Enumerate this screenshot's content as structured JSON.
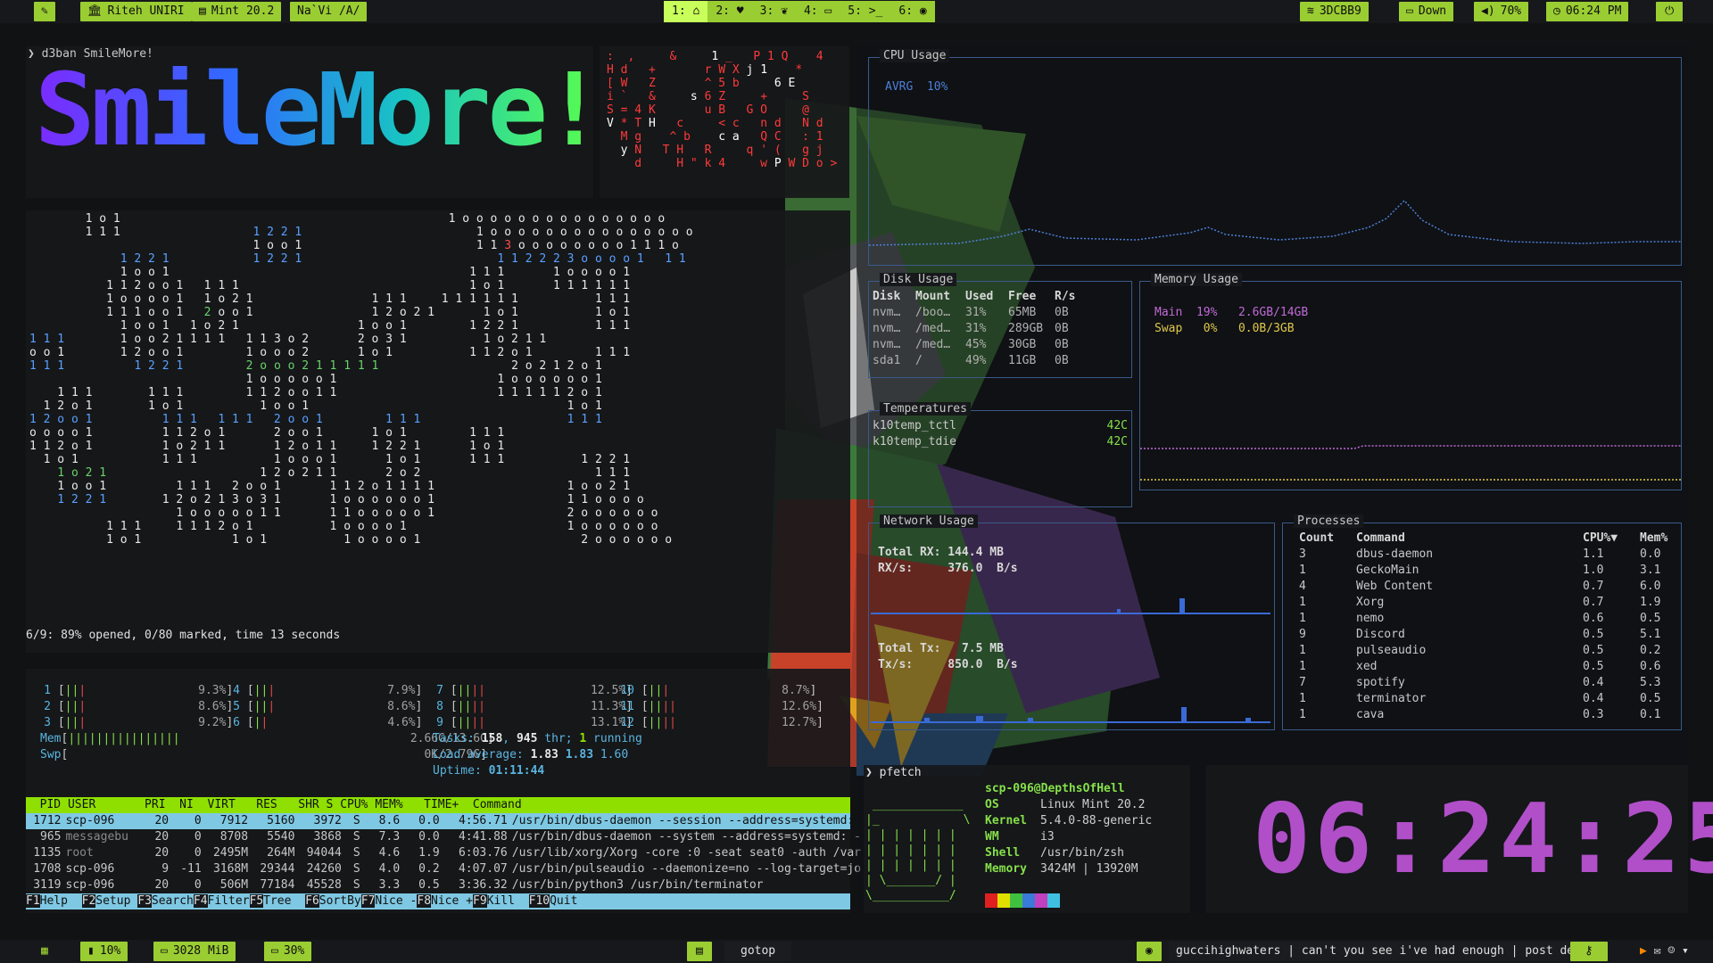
{
  "topbar": {
    "left": [
      {
        "icon": "brush-icon",
        "label": ""
      },
      {
        "icon": "bank-icon",
        "label": "Riteh UNIRI"
      },
      {
        "icon": "card-icon",
        "label": "Mint 20.2"
      },
      {
        "icon": "",
        "label": "Na`Vi /A/"
      }
    ],
    "workspaces": [
      "1:",
      "2:",
      "3:",
      "4:",
      "5:",
      "6:"
    ],
    "workspace_icons": [
      "home-icon",
      "heart-icon",
      "paw-icon",
      "monitor-icon",
      "terminal-icon",
      "spotify-icon"
    ],
    "right": [
      {
        "icon": "wifi-icon",
        "label": "3DCBB9"
      },
      {
        "icon": "folder-icon",
        "label": "Down"
      },
      {
        "icon": "volume-icon",
        "label": "70%"
      },
      {
        "icon": "clock-icon",
        "label": "06:24 PM"
      },
      {
        "icon": "power-icon",
        "label": ""
      }
    ]
  },
  "figlet": {
    "prompt": "❯ d3ban SmileMore!",
    "text": "SmileMore!"
  },
  "matrix_status": "6/9: 89% opened, 0/80 marked, time 13 seconds",
  "htop": {
    "cpus": [
      {
        "n": "1",
        "pct": "9.3%"
      },
      {
        "n": "2",
        "pct": "8.6%"
      },
      {
        "n": "3",
        "pct": "9.2%"
      },
      {
        "n": "4",
        "pct": "7.9%"
      },
      {
        "n": "5",
        "pct": "8.6%"
      },
      {
        "n": "6",
        "pct": "4.6%"
      },
      {
        "n": "7",
        "pct": "12.5%"
      },
      {
        "n": "8",
        "pct": "11.3%"
      },
      {
        "n": "9",
        "pct": "13.1%"
      },
      {
        "n": "10",
        "pct": "8.7%"
      },
      {
        "n": "11",
        "pct": "12.6%"
      },
      {
        "n": "12",
        "pct": "12.7%"
      }
    ],
    "mem": "2.66G/13.6G",
    "swp": "0K/2.79G",
    "tasks": "158",
    "thr": "945",
    "running": "1",
    "load": [
      "1.83",
      "1.83",
      "1.60"
    ],
    "uptime": "01:11:44",
    "header": "  PID USER       PRI  NI  VIRT   RES   SHR S CPU% MEM%   TIME+  Command",
    "rows": [
      {
        "pid": "1712",
        "user": "scp-096",
        "pri": "20",
        "ni": "0",
        "virt": "7912",
        "res": "5160",
        "shr": "3972",
        "s": "S",
        "cpu": "8.6",
        "mem": "0.0",
        "time": "4:56.71",
        "cmd": "/usr/bin/dbus-daemon --session --address=systemd:"
      },
      {
        "pid": "965",
        "user": "messagebu",
        "pri": "20",
        "ni": "0",
        "virt": "8708",
        "res": "5540",
        "shr": "3868",
        "s": "S",
        "cpu": "7.3",
        "mem": "0.0",
        "time": "4:41.88",
        "cmd": "/usr/bin/dbus-daemon --system --address=systemd: -"
      },
      {
        "pid": "1135",
        "user": "root",
        "pri": "20",
        "ni": "0",
        "virt": "2495M",
        "res": "264M",
        "shr": "94044",
        "s": "S",
        "cpu": "4.6",
        "mem": "1.9",
        "time": "6:03.76",
        "cmd": "/usr/lib/xorg/Xorg -core :0 -seat seat0 -auth /var"
      },
      {
        "pid": "1708",
        "user": "scp-096",
        "pri": "9",
        "ni": "-11",
        "virt": "3168M",
        "res": "29344",
        "shr": "24260",
        "s": "S",
        "cpu": "4.0",
        "mem": "0.2",
        "time": "4:07.07",
        "cmd": "/usr/bin/pulseaudio --daemonize=no --log-target=jo"
      },
      {
        "pid": "3119",
        "user": "scp-096",
        "pri": "20",
        "ni": "0",
        "virt": "506M",
        "res": "77184",
        "shr": "45528",
        "s": "S",
        "cpu": "3.3",
        "mem": "0.5",
        "time": "3:36.32",
        "cmd": "/usr/bin/python3 /usr/bin/terminator"
      }
    ],
    "fkeys": [
      {
        "k": "F1",
        "l": "Help  "
      },
      {
        "k": "F2",
        "l": "Setup "
      },
      {
        "k": "F3",
        "l": "Search"
      },
      {
        "k": "F4",
        "l": "Filter"
      },
      {
        "k": "F5",
        "l": "Tree  "
      },
      {
        "k": "F6",
        "l": "SortBy"
      },
      {
        "k": "F7",
        "l": "Nice -"
      },
      {
        "k": "F8",
        "l": "Nice +"
      },
      {
        "k": "F9",
        "l": "Kill  "
      },
      {
        "k": "F10",
        "l": "Quit"
      }
    ]
  },
  "gotop": {
    "cpu": {
      "title": "CPU Usage",
      "avg_label": "AVRG",
      "avg": "10%"
    },
    "disk": {
      "title": "Disk Usage",
      "headers": [
        "Disk",
        "Mount",
        "Used",
        "Free",
        "R/s"
      ],
      "rows": [
        [
          "nvm…",
          "/boo…",
          "31%",
          "65MB",
          "0B"
        ],
        [
          "nvm…",
          "/med…",
          "31%",
          "289GB",
          "0B"
        ],
        [
          "nvm…",
          "/med…",
          "45%",
          "30GB",
          "0B"
        ],
        [
          "sda1",
          "/",
          "49%",
          "11GB",
          "0B"
        ]
      ]
    },
    "memory": {
      "title": "Memory Usage",
      "main_label": "Main",
      "main_pct": "19%",
      "main_val": "2.6GB/14GB",
      "swap_label": "Swap",
      "swap_pct": "0%",
      "swap_val": "0.0B/3GB"
    },
    "temps": {
      "title": "Temperatures",
      "rows": [
        [
          "k10temp_tctl",
          "42C"
        ],
        [
          "k10temp_tdie",
          "42C"
        ]
      ]
    },
    "network": {
      "title": "Network Usage",
      "rx_total_label": "Total RX:",
      "rx_total": "144.4 MB",
      "rx_label": "RX/s:",
      "rx": "376.0  B/s",
      "tx_total_label": "Total Tx:",
      "tx_total": "7.5 MB",
      "tx_label": "Tx/s:",
      "tx": "850.0  B/s"
    },
    "processes": {
      "title": "Processes",
      "headers": [
        "Count",
        "Command",
        "CPU%▼",
        "Mem%"
      ],
      "rows": [
        [
          "3",
          "dbus-daemon",
          "1.1",
          "0.0"
        ],
        [
          "1",
          "GeckoMain",
          "1.0",
          "3.1"
        ],
        [
          "4",
          "Web Content",
          "0.7",
          "6.0"
        ],
        [
          "1",
          "Xorg",
          "0.7",
          "1.9"
        ],
        [
          "1",
          "nemo",
          "0.6",
          "0.5"
        ],
        [
          "9",
          "Discord",
          "0.5",
          "5.1"
        ],
        [
          "1",
          "pulseaudio",
          "0.5",
          "0.2"
        ],
        [
          "1",
          "xed",
          "0.5",
          "0.6"
        ],
        [
          "7",
          "spotify",
          "0.4",
          "5.3"
        ],
        [
          "1",
          "terminator",
          "0.4",
          "0.5"
        ],
        [
          "1",
          "cava",
          "0.3",
          "0.1"
        ]
      ]
    }
  },
  "pfetch": {
    "prompt": "❯ pfetch",
    "userhost": "scp-096@DepthsOfHell",
    "rows": [
      [
        "OS",
        "Linux Mint 20.2"
      ],
      [
        "Kernel",
        "5.4.0-88-generic"
      ],
      [
        "WM",
        "i3"
      ],
      [
        "Shell",
        "/usr/bin/zsh"
      ],
      [
        "Memory",
        "3424M | 13920M"
      ]
    ],
    "ascii": [
      " _____________",
      "|_            \\",
      "| | | | | | |",
      "| | | | | | |",
      "| | | | | | |",
      "| \\_______/ |",
      "\\___________/"
    ],
    "palette": [
      "#e02020",
      "#e0e000",
      "#40c040",
      "#3a7ad8",
      "#c040c0",
      "#40c0e0"
    ]
  },
  "clock": {
    "time": "06:24:25"
  },
  "bottombar": {
    "left": [
      {
        "icon": "grid-icon",
        "label": ""
      },
      {
        "icon": "cpu-icon",
        "label": "10%"
      },
      {
        "icon": "ram-icon",
        "label": "3028 MiB"
      },
      {
        "icon": "battery-icon",
        "label": "30%"
      }
    ],
    "center": {
      "icon": "window-icon",
      "label": "gotop"
    },
    "nowplaying": {
      "icon": "spotify-icon",
      "label": "guccihighwaters | can't you see i've had enough | post death"
    },
    "tray": [
      "key-icon",
      "vlc-icon",
      "chat-icon",
      "discord-icon",
      "chevron-down-icon"
    ]
  }
}
